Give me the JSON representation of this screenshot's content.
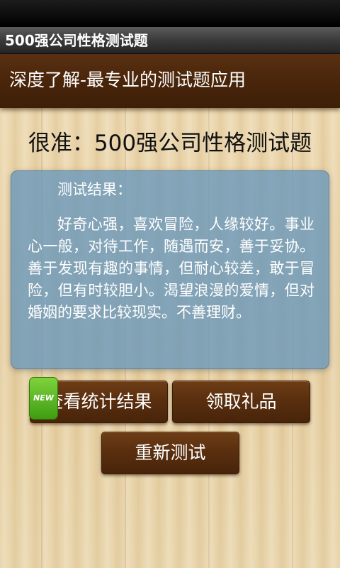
{
  "app": {
    "title": "500强公司性格测试题"
  },
  "banner": {
    "tagline": "深度了解-最专业的测试题应用"
  },
  "quiz": {
    "title": "很准：500强公司性格测试题"
  },
  "result": {
    "heading": "测试结果：",
    "body": "好奇心强，喜欢冒险，人缘较好。事业心一般，对待工作，随遇而安，善于妥协。善于发现有趣的事情，但耐心较差，敢于冒险，但有时较胆小。渴望浪漫的爱情，但对婚姻的要求比较现实。不善理财。"
  },
  "buttons": {
    "stats_label": "查看统计结果",
    "stats_badge": "NEW",
    "gift_label": "领取礼品",
    "retest_label": "重新测试"
  },
  "colors": {
    "banner": "#4b260b",
    "button": "#5a2f0f",
    "result_panel": "#6796bb",
    "new_badge": "#4fae1a"
  }
}
